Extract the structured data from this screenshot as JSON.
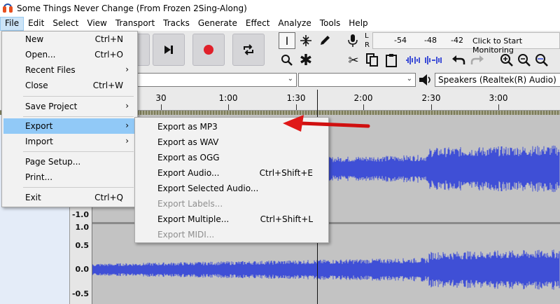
{
  "window": {
    "title": "Some Things Never Change (From Frozen 2Sing-Along)"
  },
  "menubar": [
    "File",
    "Edit",
    "Select",
    "View",
    "Transport",
    "Tracks",
    "Generate",
    "Effect",
    "Analyze",
    "Tools",
    "Help"
  ],
  "meter": {
    "channel_l": "L",
    "channel_r": "R",
    "ticks": [
      "-54",
      "-48",
      "-42"
    ],
    "hint": "Click to Start Monitoring"
  },
  "device": {
    "output": "Speakers (Realtek(R) Audio)"
  },
  "ruler": {
    "labels": [
      "30",
      "1:00",
      "1:30",
      "2:00",
      "2:30",
      "3:00"
    ]
  },
  "vscale": {
    "labels": [
      "-1.0",
      "1.0",
      "0.5",
      "0.0",
      "-0.5"
    ]
  },
  "file_menu": {
    "items": [
      {
        "label": "New",
        "shortcut": "Ctrl+N"
      },
      {
        "label": "Open...",
        "shortcut": "Ctrl+O"
      },
      {
        "label": "Recent Files",
        "submenu": "›"
      },
      {
        "label": "Close",
        "shortcut": "Ctrl+W"
      },
      {
        "label": "Save Project",
        "submenu": "›"
      },
      {
        "label": "Export",
        "submenu": "›"
      },
      {
        "label": "Import",
        "submenu": "›"
      },
      {
        "label": "Page Setup..."
      },
      {
        "label": "Print..."
      },
      {
        "label": "Exit",
        "shortcut": "Ctrl+Q"
      }
    ]
  },
  "export_menu": {
    "items": [
      {
        "label": "Export as MP3"
      },
      {
        "label": "Export as WAV"
      },
      {
        "label": "Export as OGG"
      },
      {
        "label": "Export Audio...",
        "shortcut": "Ctrl+Shift+E"
      },
      {
        "label": "Export Selected Audio..."
      },
      {
        "label": "Export Labels..."
      },
      {
        "label": "Export Multiple...",
        "shortcut": "Ctrl+Shift+L"
      },
      {
        "label": "Export MIDI..."
      }
    ]
  },
  "colors": {
    "accent_highlight": "#91c9f7",
    "waveform": "#3f4fd6",
    "annotation_arrow": "#e01818"
  }
}
